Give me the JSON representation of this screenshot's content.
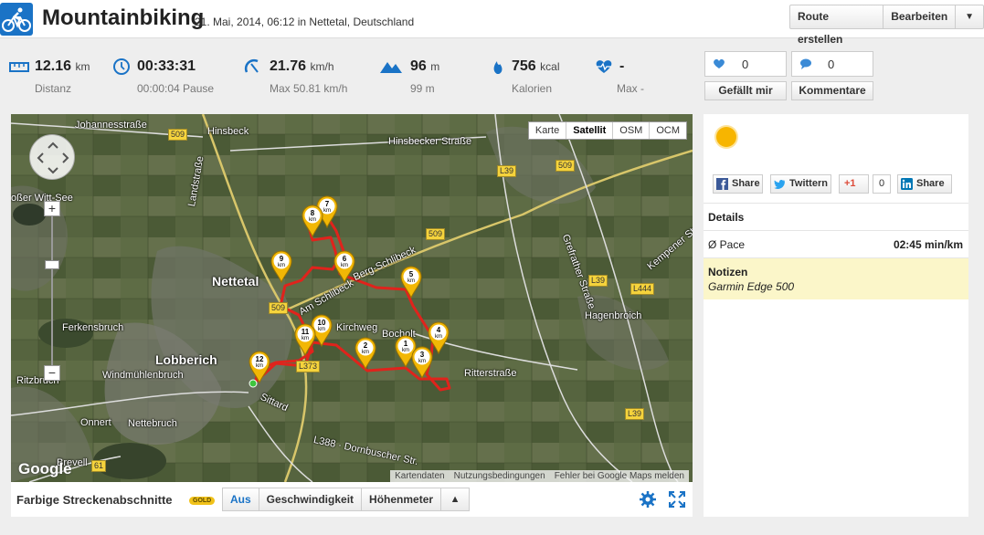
{
  "header": {
    "title": "Mountainbiking",
    "subtitle": "21. Mai, 2014, 06:12 in Nettetal, Deutschland",
    "buttons": {
      "create_route": "Route erstellen",
      "edit": "Bearbeiten",
      "dropdown": "▼"
    }
  },
  "stats": [
    {
      "icon": "ruler-icon",
      "value": "12.16",
      "unit": "km",
      "sub": "Distanz"
    },
    {
      "icon": "clock-icon",
      "value": "00:33:31",
      "unit": "",
      "sub": "00:00:04 Pause"
    },
    {
      "icon": "speedometer-icon",
      "value": "21.76",
      "unit": "km/h",
      "sub": "Max 50.81 km/h"
    },
    {
      "icon": "mountain-icon",
      "value": "96",
      "unit": "m",
      "sub": "99 m"
    },
    {
      "icon": "flame-icon",
      "value": "756",
      "unit": "kcal",
      "sub": "Kalorien"
    },
    {
      "icon": "heartbeat-icon",
      "value": "-",
      "unit": "",
      "sub": "Max -"
    }
  ],
  "social": {
    "likes": {
      "count": "0",
      "label": "Gefällt mir"
    },
    "comments": {
      "count": "0",
      "label": "Kommentare"
    }
  },
  "map": {
    "types": [
      "Karte",
      "Satellit",
      "OSM",
      "OCM"
    ],
    "active_type": "Satellit",
    "zoom_in": "+",
    "zoom_out": "−",
    "labels": {
      "johannesstrasse": "Johannesstraße",
      "hinsbeck": "Hinsbeck",
      "hinsbecker": "Hinsbecker Straße",
      "nettetal": "Nettetal",
      "lobberich": "Lobberich",
      "ferkensbruch": "Ferkensbruch",
      "windmuehlenbruch": "Windmühlenbruch",
      "ritzbruch": "Ritzbruch",
      "onnert": "Onnert",
      "nettebruch": "Nettebruch",
      "bocholt": "Bocholt",
      "ritterstrasse": "Ritterstraße",
      "hagenbroich": "Hagenbroich",
      "landstrasse": "Landstraße",
      "sittard": "Sittard",
      "dornbuscher": "L388 · Dornbuscher Str.",
      "schlibeck": "Am Schlibeck",
      "berg_schlibeck": "Berg-Schlibeck",
      "kirchweg": "Kirchweg",
      "kempener": "Kempener Str.",
      "brevell": "Brevell",
      "schwitt": "oßer Witt-See",
      "grefrather": "Grefrather Straße"
    },
    "road_badges": [
      "509",
      "509",
      "509",
      "509",
      "L39",
      "L373",
      "61",
      "L444",
      "L39",
      "L39"
    ],
    "markers": [
      "1",
      "2",
      "3",
      "4",
      "5",
      "6",
      "7",
      "8",
      "9",
      "10",
      "11",
      "12"
    ],
    "marker_unit": "km",
    "google": "Google",
    "footer": [
      "Kartendaten",
      "Nutzungsbedingungen",
      "Fehler bei Google Maps melden"
    ]
  },
  "mapbar": {
    "label": "Farbige Streckenabschnitte",
    "badge": "GOLD",
    "options": [
      "Aus",
      "Geschwindigkeit",
      "Höhenmeter"
    ],
    "active_option": "Aus",
    "toggle": "▲"
  },
  "panel": {
    "share": {
      "facebook": "Share",
      "twitter": "Twittern",
      "gplus": "+1",
      "gplus_count": "0",
      "linkedin": "Share"
    },
    "details_title": "Details",
    "pace_label": "Ø Pace",
    "pace_value": "02:45 min/km",
    "notes_title": "Notizen",
    "notes_text": "Garmin Edge 500"
  },
  "colors": {
    "accent": "#1a73c6",
    "route": "#e0231c",
    "marker": "#f2b705",
    "notes_bg": "#fbf6c9"
  }
}
